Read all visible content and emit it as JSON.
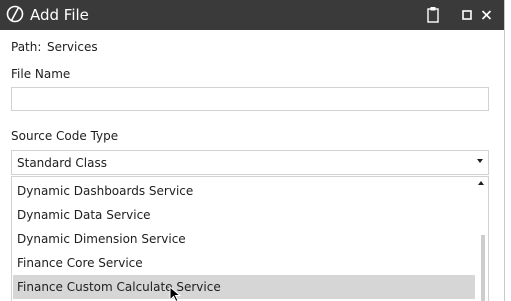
{
  "window": {
    "title": "Add File",
    "colors": {
      "titlebar": "#3a3a3a",
      "hover_row": "#d6d6d6"
    },
    "icons": [
      "app-logo-icon",
      "clipboard-icon",
      "maximize-icon",
      "close-icon"
    ]
  },
  "path": {
    "label": "Path:",
    "value": "Services"
  },
  "file_name": {
    "label": "File Name",
    "value": "",
    "placeholder": ""
  },
  "source_code_type": {
    "label": "Source Code Type",
    "selected": "Standard Class",
    "options": [
      "Dynamic Dashboards Service",
      "Dynamic Data Service",
      "Dynamic Dimension Service",
      "Finance Core Service",
      "Finance Custom Calculate Service"
    ],
    "hovered_option": "Finance Custom Calculate Service"
  }
}
